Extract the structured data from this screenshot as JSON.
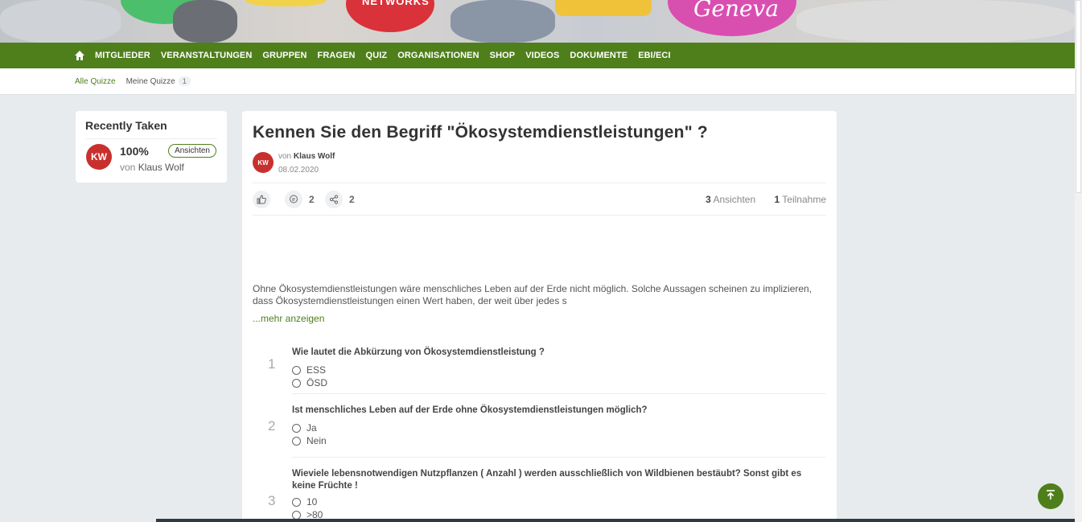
{
  "banner": {
    "bubble_text_1": "NETWORKS",
    "bubble_text_2": "Geneva"
  },
  "nav": {
    "items": [
      "MITGLIEDER",
      "VERANSTALTUNGEN",
      "GRUPPEN",
      "FRAGEN",
      "QUIZ",
      "ORGANISATIONEN",
      "SHOP",
      "VIDEOS",
      "DOKUMENTE",
      "EBI/ECI"
    ]
  },
  "subnav": {
    "all": "Alle Quizze",
    "mine": "Meine Quizze",
    "mine_count": "1"
  },
  "sidebar": {
    "title": "Recently Taken",
    "avatar": "KW",
    "percent": "100%",
    "by_prefix": "von",
    "author": "Klaus Wolf",
    "view_button": "Ansichten"
  },
  "quiz": {
    "title": "Kennen Sie den Begriff \"Ökosystemdienstleistungen\" ?",
    "avatar": "KW",
    "by_prefix": "von",
    "author": "Klaus Wolf",
    "date": "08.02.2020",
    "comments": "2",
    "shares": "2",
    "views_count": "3",
    "views_label": "Ansichten",
    "participants_count": "1",
    "participants_label": "Teilnahme",
    "description": "Ohne Ökosystemdienstleistungen wäre menschliches Leben auf der Erde nicht möglich. Solche Aussagen scheinen zu implizieren, dass Ökosystemdienstleistungen einen Wert haben, der weit über jedes s",
    "more": "...mehr anzeigen",
    "questions": [
      {
        "num": "1",
        "text": "Wie lautet die Abkürzung von Ökosystemdienstleistung ?",
        "options": [
          "ESS",
          "ÖSD"
        ]
      },
      {
        "num": "2",
        "text": "Ist menschliches Leben auf der Erde ohne Ökosystemdienstleistungen möglich?",
        "options": [
          "Ja",
          "Nein"
        ]
      },
      {
        "num": "3",
        "text": "Wieviele lebensnotwendigen Nutzpflanzen ( Anzahl ) werden ausschließlich von Wildbienen bestäubt? Sonst gibt es keine Früchte !",
        "options": [
          "10",
          ">80"
        ]
      }
    ]
  }
}
